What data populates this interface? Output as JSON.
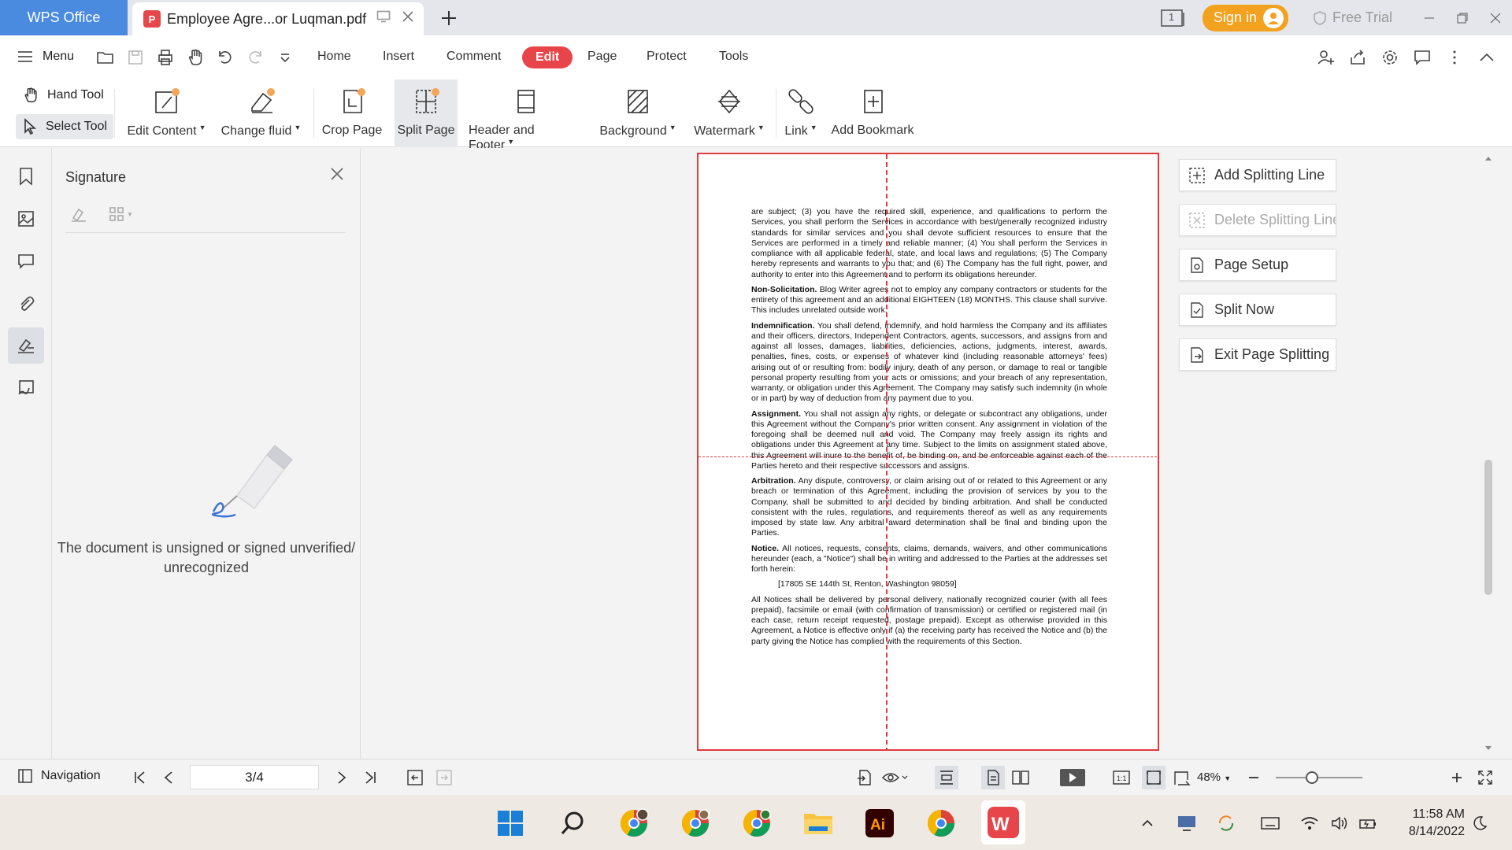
{
  "titlebar": {
    "app_tab": "WPS Office",
    "doc_tab": "Employee Agre...or Luqman.pdf",
    "signin": "Sign in",
    "free_trial": "Free Trial",
    "window_count": "1"
  },
  "menu": {
    "menu_label": "Menu",
    "tabs": [
      "Home",
      "Insert",
      "Comment",
      "Edit",
      "Page",
      "Protect",
      "Tools"
    ],
    "active_tab": "Edit"
  },
  "toolbar": {
    "hand_tool": "Hand Tool",
    "select_tool": "Select Tool",
    "edit_content": "Edit Content",
    "change_fluid": "Change fluid",
    "crop_page": "Crop Page",
    "split_page": "Split Page",
    "header_footer": "Header and Footer",
    "background": "Background",
    "watermark": "Watermark",
    "link": "Link",
    "add_bookmark": "Add Bookmark"
  },
  "signature_panel": {
    "title": "Signature",
    "message": "The document is unsigned or signed unverified/ unrecognized"
  },
  "split_panel": {
    "add_line": "Add Splitting Line",
    "delete_line": "Delete Splitting Line",
    "page_setup": "Page Setup",
    "split_now": "Split Now",
    "exit": "Exit Page Splitting"
  },
  "document": {
    "p1": "are subject; (3) you have the required skill, experience, and qualifications to perform the Services, you shall perform the Services in accordance with best/generally recognized industry standards for similar services and you shall devote sufficient resources to ensure that the Services are performed in a timely and reliable manner; (4) You shall perform the Services in compliance with all applicable federal, state, and local laws and regulations; (5) The Company hereby represents and warrants to you that; and (6) The Company has the full right, power, and authority to enter into this Agreement and to perform its obligations hereunder.",
    "p2_head": "Non-Solicitation.",
    "p2": " Blog Writer agrees not to employ any company contractors or students for the entirety of this agreement and an additional EIGHTEEN (18) MONTHS. This clause shall survive. This includes unrelated outside work.",
    "p3_head": "Indemnification.",
    "p3": " You shall defend, indemnify, and hold harmless the Company and its affiliates and their officers, directors, Independent Contractors, agents, successors, and assigns from and against all losses, damages, liabilities, deficiencies, actions, judgments, interest, awards, penalties, fines, costs, or expenses of whatever kind (including reasonable attorneys' fees) arising out of or resulting from: bodily injury, death of any person, or damage to real or tangible personal property resulting from your acts or omissions; and your breach of any representation, warranty, or obligation under this Agreement. The Company may satisfy such indemnity (in whole or in part) by way of deduction from any payment due to you.",
    "p4_head": "Assignment.",
    "p4": " You shall not assign any rights, or delegate or subcontract any obligations, under this Agreement without the Company's prior written consent. Any assignment in violation of the foregoing shall be deemed null and void. The Company may freely assign its rights and obligations under this Agreement at any time. Subject to the limits on assignment stated above, this Agreement will inure to the benefit of, be binding on, and be enforceable against each of the Parties hereto and their respective successors and assigns.",
    "p5_head": "Arbitration.",
    "p5": " Any dispute, controversy, or claim arising out of or related to this Agreement or any breach or termination of this Agreement, including the provision of services by you to the Company, shall be submitted to and decided by binding arbitration. And shall be conducted consistent with the rules, regulations, and requirements thereof as well as any requirements imposed by state law. Any arbitral award determination shall be final and binding upon the Parties.",
    "p6_head": "Notice.",
    "p6": " All notices, requests, consents, claims, demands, waivers, and other communications hereunder (each, a \"Notice\") shall be in writing and addressed to the Parties at the addresses set forth herein:",
    "address": "[17805 SE 144th St, Renton, Washington 98059]",
    "p7": "All Notices shall be delivered by personal delivery, nationally recognized courier (with all fees prepaid), facsimile or email (with confirmation of transmission) or certified or registered mail (in each case, return receipt requested, postage prepaid). Except as otherwise provided in this Agreement, a Notice is effective only if (a) the receiving party has received the Notice and (b) the party giving the Notice has complied with the requirements of this Section."
  },
  "statusbar": {
    "navigation": "Navigation",
    "page_indicator": "3/4",
    "zoom": "48%",
    "zoom_level": 0.48
  },
  "taskbar": {
    "time": "11:58 AM",
    "date": "8/14/2022"
  },
  "colors": {
    "accent_red": "#e8454a",
    "wps_blue": "#4a8bdf",
    "signin_orange": "#f3a21f"
  }
}
